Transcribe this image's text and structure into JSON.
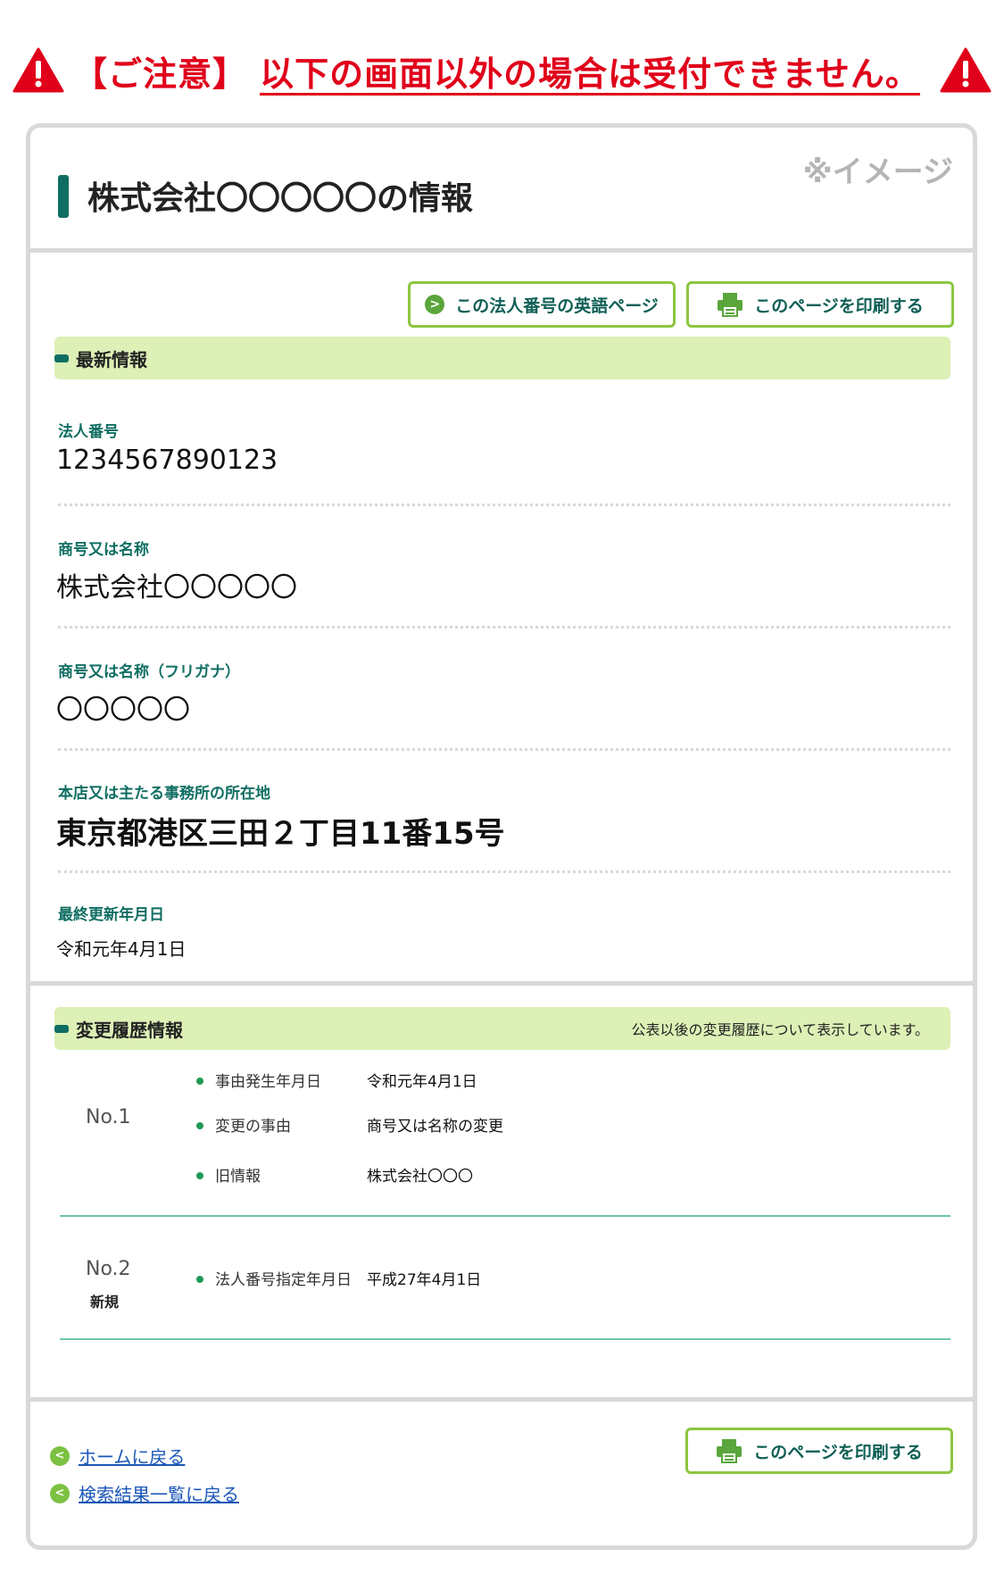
{
  "warning": {
    "prefix": "【ご注意】",
    "message": "以下の画面以外の場合は受付できません。"
  },
  "card": {
    "title": "株式会社〇〇〇〇〇の情報",
    "image_note": "※イメージ"
  },
  "toolbar": {
    "english_page_label": "この法人番号の英語ページ",
    "print_label": "このページを印刷する"
  },
  "latest": {
    "section_title": "最新情報",
    "fields": [
      {
        "label": "法人番号",
        "value": "1234567890123"
      },
      {
        "label": "商号又は名称",
        "value": "株式会社〇〇〇〇〇"
      },
      {
        "label": "商号又は名称（フリガナ）",
        "value": "〇〇〇〇〇"
      },
      {
        "label": "本店又は主たる事務所の所在地",
        "value": "東京都港区三田２丁目11番15号"
      },
      {
        "label": "最終更新年月日",
        "value": "令和元年4月1日"
      }
    ]
  },
  "history": {
    "section_title": "変更履歴情報",
    "note": "公表以後の変更履歴について表示しています。",
    "entries": [
      {
        "no": "No.1",
        "sub": "",
        "items": [
          {
            "key": "事由発生年月日",
            "value": "令和元年4月1日"
          },
          {
            "key": "変更の事由",
            "value": "商号又は名称の変更"
          },
          {
            "key": "旧情報",
            "value": "株式会社〇〇〇"
          }
        ]
      },
      {
        "no": "No.2",
        "sub": "新規",
        "items": [
          {
            "key": "法人番号指定年月日",
            "value": "平成27年4月1日"
          }
        ]
      }
    ]
  },
  "footer": {
    "home_link": "ホームに戻る",
    "results_link": "検索結果一覧に戻る",
    "print_label": "このページを印刷する"
  },
  "icons": {
    "warning": "warning-triangle-icon",
    "arrow": "circle-arrow-icon",
    "printer": "printer-icon"
  },
  "colors": {
    "warning_red": "#e0001a",
    "brand_green": "#0f6e62",
    "button_border": "#8cc63f",
    "section_bg": "#ddf0b6",
    "link_blue": "#1a56b8"
  }
}
